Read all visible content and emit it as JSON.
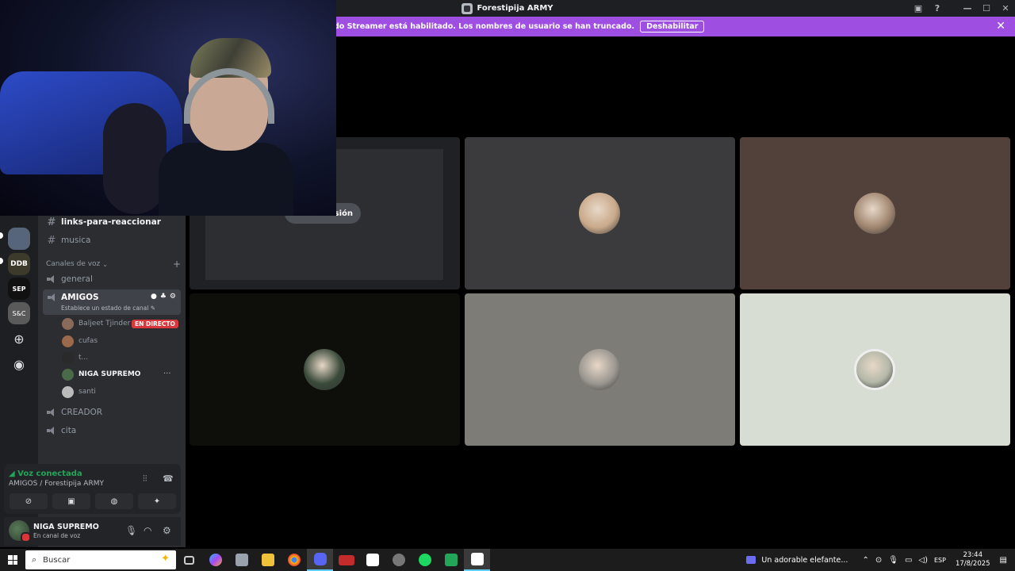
{
  "window": {
    "title": "Forestipija ARMY"
  },
  "banner": {
    "text": "El modo Streamer está habilitado. Los nombres de usuario se han truncado.",
    "button": "Deshabilitar",
    "close": "✕"
  },
  "channels": {
    "text": [
      {
        "name": "links-para-reaccionar"
      },
      {
        "name": "musica"
      }
    ],
    "voice_category": "Canales de voz",
    "voice": {
      "general": "general",
      "amigos": {
        "name": "AMIGOS",
        "status": "Establece un estado de canal"
      },
      "creador": "CREADOR",
      "cita": "cita"
    },
    "users": [
      {
        "name": "Baljeet Tjinder",
        "badge": "EN DIRECTO",
        "avatar": "#8a6a5a"
      },
      {
        "name": "cufas",
        "avatar": "#9a6a4a"
      },
      {
        "name": "t...",
        "avatar": "#2a2a2a"
      },
      {
        "name": "NIGA SUPREMO",
        "avatar": "#4a6a4a"
      },
      {
        "name": "santi",
        "avatar": "#bbbbbb"
      }
    ]
  },
  "servers": [
    {
      "label": "",
      "color": "#56657a"
    },
    {
      "label": "DDB",
      "color": "#3c3a2a"
    },
    {
      "label": "SEP",
      "color": "#111111"
    },
    {
      "label": "S&C",
      "color": "#5a5a5a"
    }
  ],
  "voice_panel": {
    "status": "Voz conectada",
    "channel": "AMIGOS / Forestipija ARMY"
  },
  "user_panel": {
    "name": "NIGA SUPREMO",
    "status": "En canal de voz"
  },
  "share": {
    "label": "isión"
  },
  "tiles": [
    {
      "bg": "#202124"
    },
    {
      "bg": "#3b3a3d",
      "avatar": "#c9a98a"
    },
    {
      "bg": "#52413a",
      "avatar": "#a08670"
    },
    {
      "bg": "#0e0e0b",
      "avatar": "#3a4a3a"
    },
    {
      "bg": "#7e7c77",
      "avatar": "#9a9690"
    },
    {
      "bg": "#d8ddd3",
      "avatar": "#b4b8a8"
    }
  ],
  "taskbar": {
    "search_placeholder": "Buscar",
    "media": "Un adorable elefante...",
    "lang": "ESP",
    "time": "23:44",
    "date": "17/8/2025"
  }
}
